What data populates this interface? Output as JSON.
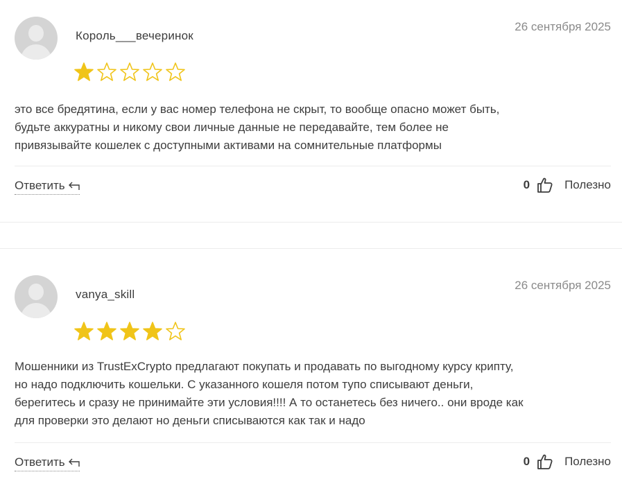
{
  "reviews": [
    {
      "author": "Король___вечеринок",
      "date": "26 сентября 2025",
      "rating": 1,
      "max_rating": 5,
      "text_lines": [
        "это все бредятина, если у вас номер телефона не скрыт, то вообще опасно может быть,",
        "будьте аккуратны и никому свои личные данные не передавайте, тем более не",
        "привязывайте кошелек с доступными активами на сомнительные платформы"
      ],
      "reply_label": "Ответить",
      "useful_count": "0",
      "useful_label": "Полезно"
    },
    {
      "author": "vanya_skill",
      "date": "26 сентября 2025",
      "rating": 4,
      "max_rating": 5,
      "text_lines": [
        "Мошенники из TrustExCrypto предлагают покупать и продавать по выгодному курсу крипту,",
        "но надо подключить кошельки. С указанного кошеля потом тупо списывают деньги,",
        "берегитесь и сразу не принимайте эти условия!!!! А то останетесь без ничего.. они вроде как",
        "для проверки это делают но деньги списываются как так и надо"
      ],
      "reply_label": "Ответить",
      "useful_count": "0",
      "useful_label": "Полезно"
    }
  ],
  "colors": {
    "star_fill": "#f0c419",
    "star_outline": "#f0c419",
    "text": "#3d3d3d",
    "muted": "#8a8a8a"
  },
  "icons": {
    "reply": "reply-arrow-icon",
    "useful": "thumbs-up-icon",
    "avatar": "user-avatar-icon"
  }
}
